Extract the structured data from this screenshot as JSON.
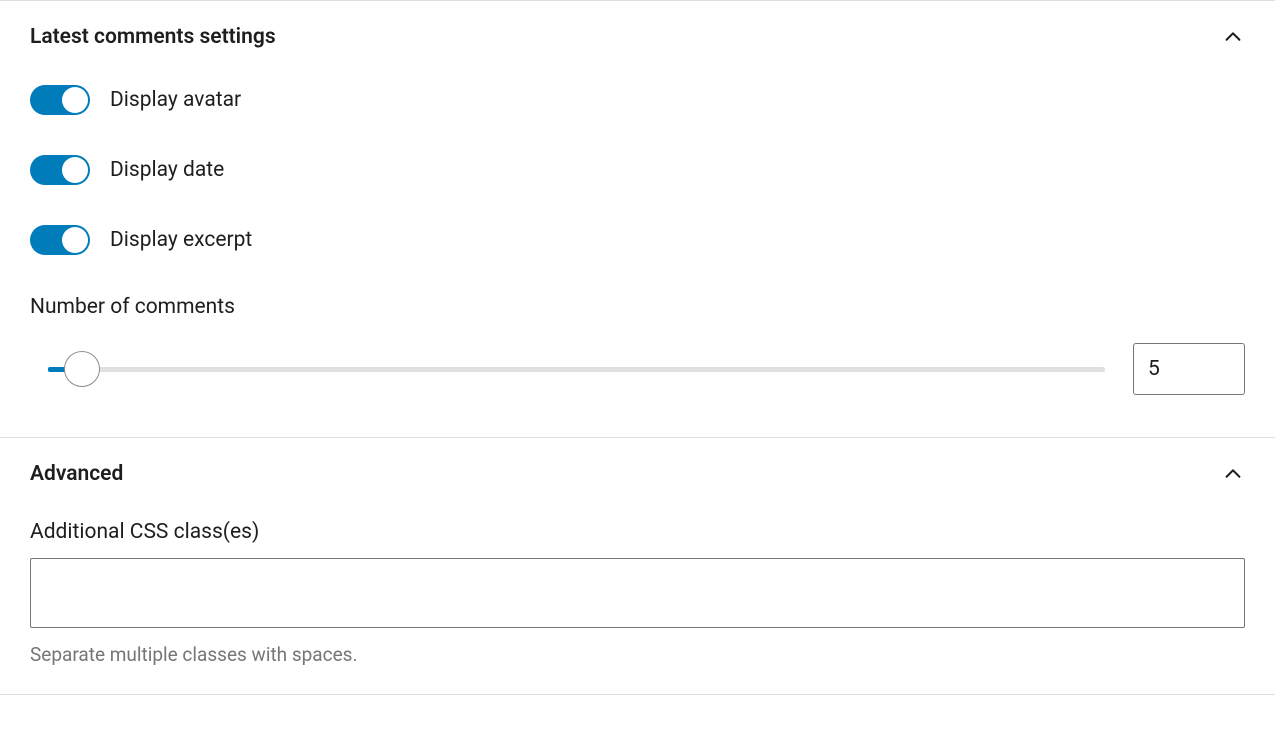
{
  "panels": {
    "latestComments": {
      "title": "Latest comments settings",
      "toggles": {
        "avatar": {
          "label": "Display avatar",
          "on": true
        },
        "date": {
          "label": "Display date",
          "on": true
        },
        "excerpt": {
          "label": "Display excerpt",
          "on": true
        }
      },
      "numComments": {
        "label": "Number of comments",
        "value": "5",
        "min": 1,
        "max": 100
      }
    },
    "advanced": {
      "title": "Advanced",
      "cssClass": {
        "label": "Additional CSS class(es)",
        "value": "",
        "help": "Separate multiple classes with spaces."
      }
    }
  }
}
